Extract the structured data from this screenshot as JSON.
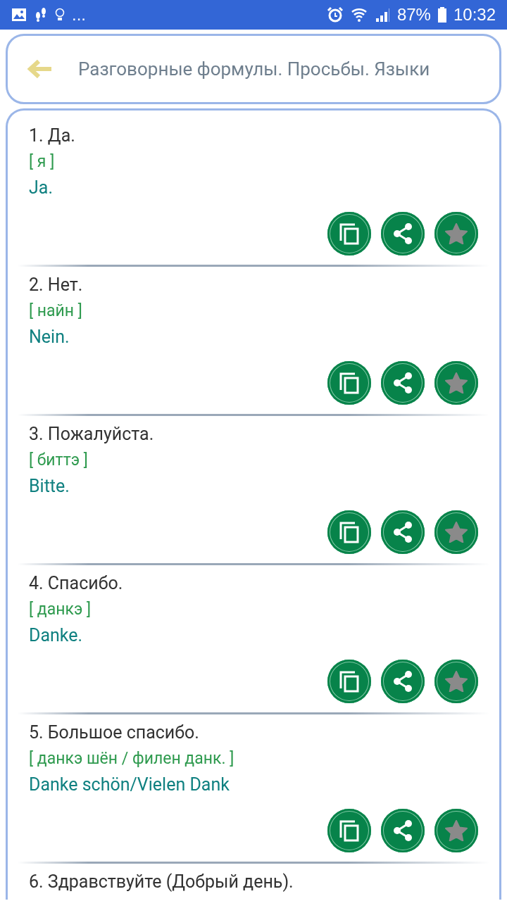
{
  "status_bar": {
    "more": "...",
    "battery": "87%",
    "time": "10:32"
  },
  "header": {
    "title": "Разговорные формулы. Просьбы. Языки"
  },
  "phrases": [
    {
      "title": "1. Да.",
      "transcription": "[ я ]",
      "translation": "Ja.",
      "favorite": false
    },
    {
      "title": "2. Нет.",
      "transcription": "[ найн ]",
      "translation": "Nein.",
      "favorite": false
    },
    {
      "title": "3. Пожалуйста.",
      "transcription": "[ биттэ ]",
      "translation": "Bitte.",
      "favorite": false
    },
    {
      "title": "4. Спасибо.",
      "transcription": "[ данкэ ]",
      "translation": "Danke.",
      "favorite": false
    },
    {
      "title": "5. Большое спасибо.",
      "transcription": "[ данкэ шён / филен данк. ]",
      "translation": "Danke schön/Vielen Dank",
      "favorite": false
    },
    {
      "title": "6. Здравствуйте (Добрый день)."
    }
  ]
}
